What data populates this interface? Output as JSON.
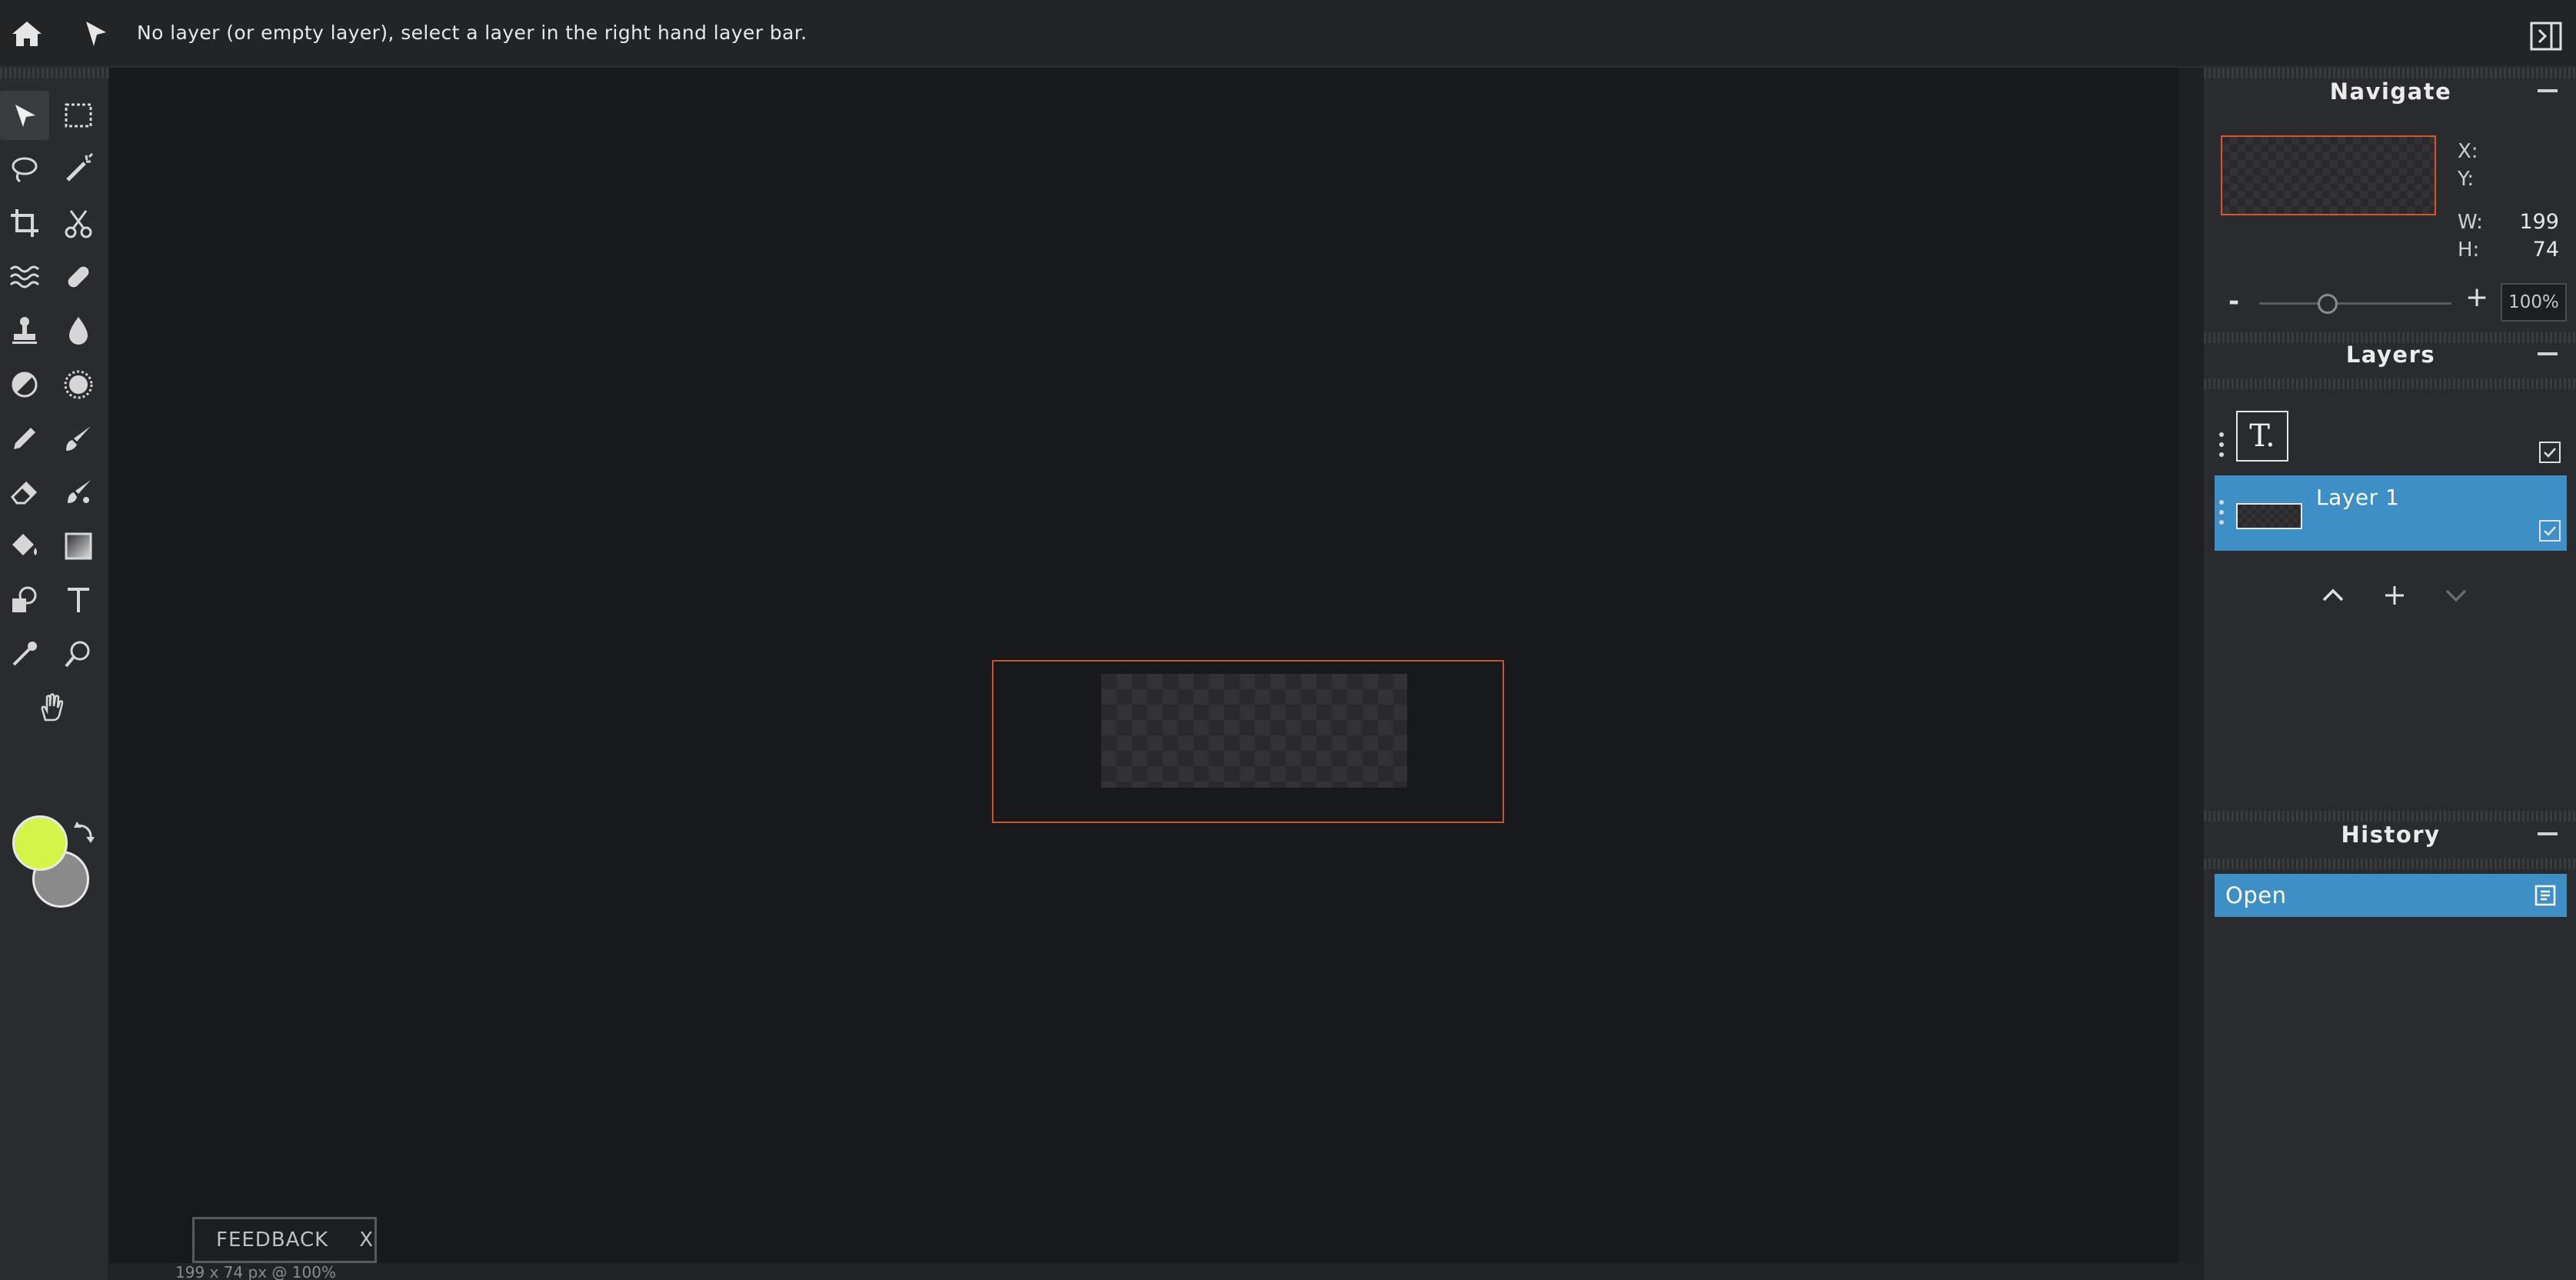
{
  "topbar": {
    "status_text": "No layer (or empty layer), select a layer in the right hand layer bar."
  },
  "toolbar": {
    "tools": [
      "select-arrow",
      "rect-select",
      "lasso",
      "magic-wand",
      "crop",
      "scissors",
      "wave-filter",
      "bandage",
      "stamp",
      "blur-drop",
      "dodge-burn",
      "sponge",
      "pencil",
      "brush",
      "eraser",
      "mixer-brush",
      "paint-bucket",
      "gradient",
      "shapes",
      "text",
      "eyedropper",
      "zoom",
      "hand"
    ],
    "active_tool": "select-arrow",
    "foreground_color": "#d4f44a",
    "background_color": "#8a8a8a"
  },
  "canvas": {
    "size_info": "199 x 74 px @ 100%"
  },
  "feedback": {
    "label": "FEEDBACK",
    "close": "X"
  },
  "navigate": {
    "title": "Navigate",
    "x_label": "X:",
    "y_label": "Y:",
    "w_label": "W:",
    "h_label": "H:",
    "w_value": "199",
    "h_value": "74",
    "zoom_minus": "-",
    "zoom_plus": "+",
    "zoom_value": "100%",
    "zoom_level": 1.0
  },
  "layers": {
    "title": "Layers",
    "items": [
      {
        "name": "",
        "type": "text",
        "thumb_glyph": "T.",
        "visible": true,
        "selected": false
      },
      {
        "name": "Layer 1",
        "type": "image",
        "visible": true,
        "selected": true
      }
    ]
  },
  "history": {
    "title": "History",
    "items": [
      {
        "label": "Open",
        "selected": true
      }
    ]
  },
  "colors": {
    "accent": "#3d8fc6",
    "frame": "#c9562a"
  }
}
